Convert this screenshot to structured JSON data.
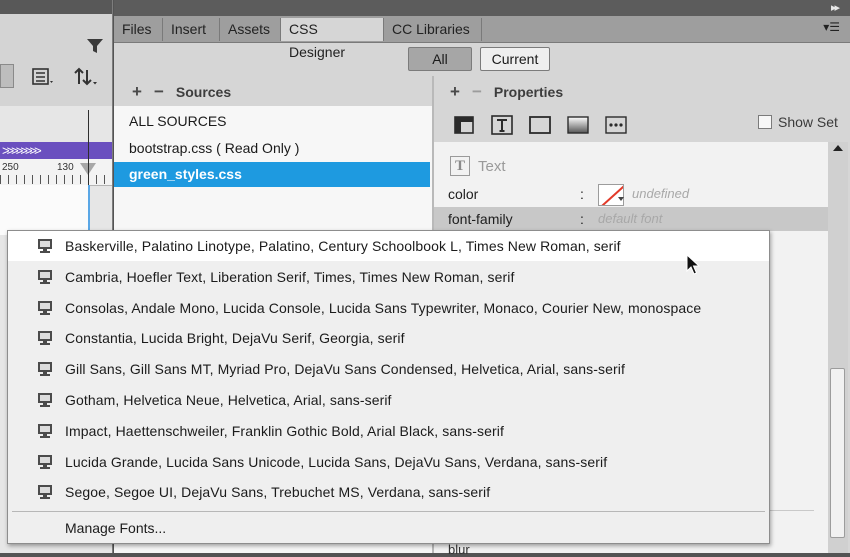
{
  "left_pane": {
    "ruler_marks": [
      "250",
      "130"
    ]
  },
  "panel": {
    "tabs": [
      "Files",
      "Insert",
      "Assets",
      "CSS Designer",
      "CC Libraries"
    ],
    "active_tab": "CSS Designer",
    "toggle": {
      "all": "All",
      "current": "Current"
    },
    "sources": {
      "header": "Sources",
      "items": [
        "ALL SOURCES",
        "bootstrap.css  ( Read Only )",
        "green_styles.css"
      ],
      "selected": "green_styles.css"
    },
    "properties": {
      "header": "Properties",
      "show_set_label": "Show Set",
      "section_title": "Text",
      "rows": [
        {
          "name": "color",
          "value": "undefined"
        },
        {
          "name": "font-family",
          "value": "default font"
        }
      ],
      "bottom_label": "blur"
    }
  },
  "font_dropdown": {
    "options": [
      "Baskerville, Palatino Linotype, Palatino, Century Schoolbook L, Times New Roman, serif",
      "Cambria, Hoefler Text, Liberation Serif, Times, Times New Roman, serif",
      "Consolas, Andale Mono, Lucida Console, Lucida Sans Typewriter, Monaco, Courier New, monospace",
      "Constantia, Lucida Bright, DejaVu Serif, Georgia, serif",
      "Gill Sans, Gill Sans MT, Myriad Pro, DejaVu Sans Condensed, Helvetica, Arial, sans-serif",
      "Gotham, Helvetica Neue, Helvetica, Arial, sans-serif",
      "Impact, Haettenschweiler, Franklin Gothic Bold, Arial Black, sans-serif",
      "Lucida Grande, Lucida Sans Unicode, Lucida Sans, DejaVu Sans, Verdana, sans-serif",
      "Segoe, Segoe UI, DejaVu Sans, Trebuchet MS, Verdana, sans-serif"
    ],
    "hovered_index": 0,
    "manage_label": "Manage Fonts..."
  },
  "colors": {
    "selection": "#1e9ae0",
    "ruler_accent": "#6a4fbf",
    "swatch_slash": "#e23a2a"
  }
}
